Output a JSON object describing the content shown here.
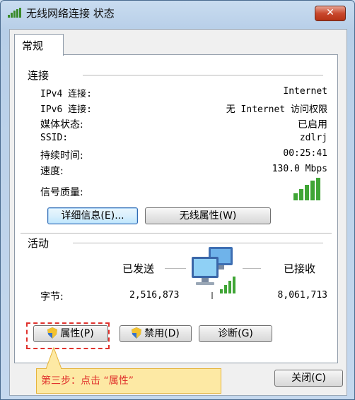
{
  "window": {
    "title": "无线网络连接 状态",
    "close_glyph": "✕"
  },
  "tabs": [
    {
      "label": "常规"
    }
  ],
  "connection": {
    "heading": "连接",
    "rows": [
      {
        "key": "IPv4 连接:",
        "value": "Internet"
      },
      {
        "key": "IPv6 连接:",
        "value": "无 Internet 访问权限"
      },
      {
        "key": "媒体状态:",
        "value": "已启用"
      },
      {
        "key": "SSID:",
        "value": "zdlrj"
      },
      {
        "key": "持续时间:",
        "value": "00:25:41"
      },
      {
        "key": "速度:",
        "value": "130.0 Mbps"
      }
    ],
    "signal_label": "信号质量:",
    "signal_bars_filled": 5,
    "details_button": "详细信息(E)...",
    "wireless_props_button": "无线属性(W)"
  },
  "activity": {
    "heading": "活动",
    "sent_label": "已发送",
    "received_label": "已接收",
    "bytes_label": "字节:",
    "bytes_sent": "2,516,873",
    "bytes_received": "8,061,713",
    "properties_button": "属性(P)",
    "disable_button": "禁用(D)",
    "diagnose_button": "诊断(G)"
  },
  "footer": {
    "close_button": "关闭(C)"
  },
  "annotation": {
    "text": "第三步：点击 “属性”",
    "color": "#e0322d"
  },
  "icons": [
    "signal-icon",
    "network-computers-icon",
    "uac-shield-icon",
    "close-icon"
  ]
}
